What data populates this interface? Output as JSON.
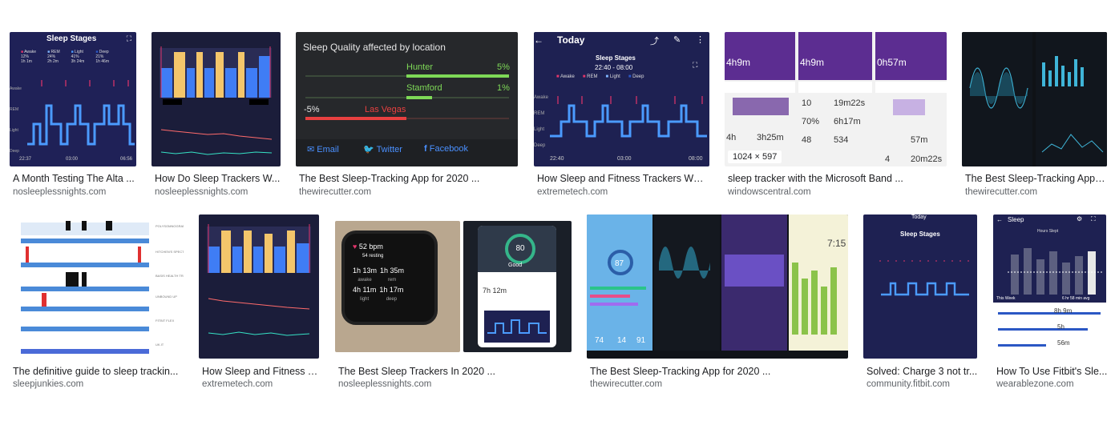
{
  "results": [
    {
      "title": "A Month Testing The Alta ...",
      "domain": "nosleeplessnights.com"
    },
    {
      "title": "How Do Sleep Trackers W...",
      "domain": "nosleeplessnights.com"
    },
    {
      "title": "The Best Sleep-Tracking App for 2020 ...",
      "domain": "thewirecutter.com"
    },
    {
      "title": "How Sleep and Fitness Trackers Wor...",
      "domain": "extremetech.com"
    },
    {
      "title": "sleep tracker with the Microsoft Band ...",
      "domain": "windowscentral.com",
      "size_badge": "1024 × 597"
    },
    {
      "title": "The Best Sleep-Tracking App f...",
      "domain": "thewirecutter.com"
    },
    {
      "title": "The definitive guide to sleep trackin...",
      "domain": "sleepjunkies.com"
    },
    {
      "title": "How Sleep and Fitness T...",
      "domain": "extremetech.com"
    },
    {
      "title": "The Best Sleep Trackers In 2020 ...",
      "domain": "nosleeplessnights.com"
    },
    {
      "title": "The Best Sleep-Tracking App for 2020 ...",
      "domain": "thewirecutter.com"
    },
    {
      "title": "Solved: Charge 3 not tr...",
      "domain": "community.fitbit.com"
    },
    {
      "title": "How To Use Fitbit's Sle...",
      "domain": "wearablezone.com"
    }
  ],
  "thumb1": {
    "heading": "Sleep Stages",
    "legend": [
      {
        "label": "Awake",
        "pct": "12%",
        "dur": "1h 1m"
      },
      {
        "label": "REM",
        "pct": "24%",
        "dur": "2h 2m"
      },
      {
        "label": "Light",
        "pct": "41%",
        "dur": "3h 24m"
      },
      {
        "label": "Deep",
        "pct": "21%",
        "dur": "1h 46m"
      }
    ],
    "axis": [
      "Awake",
      "REM",
      "Light",
      "Deep"
    ],
    "times": [
      "22:37",
      "03:00",
      "06:56"
    ]
  },
  "thumb3": {
    "heading": "Sleep Quality affected by location",
    "rows": [
      {
        "name": "Hunter",
        "value": "5%"
      },
      {
        "name": "Stamford",
        "value": "1%"
      },
      {
        "name": "Las Vegas",
        "value": "-5%"
      }
    ],
    "share": [
      "Email",
      "Twitter",
      "Facebook"
    ]
  },
  "thumb4": {
    "title": "Today",
    "heading": "Sleep Stages",
    "range": "22:40 - 08:00",
    "legend": [
      "Awake",
      "REM",
      "Light",
      "Deep"
    ],
    "axis": [
      "Awake",
      "REM",
      "Light",
      "Deep"
    ],
    "times": [
      "22:40",
      "03:00",
      "08:00"
    ]
  },
  "thumb9": {
    "watch": {
      "bpm": "52 bpm",
      "resting": "54 resting",
      "awake": "1h 13m",
      "awake_label": "awake",
      "rem": "1h 35m",
      "rem_label": "rem",
      "light": "4h 11m",
      "light_label": "light",
      "deep": "1h 17m",
      "deep_label": "deep"
    },
    "phone": {
      "score": "80",
      "quality": "Good",
      "asleep": "7h 12m"
    }
  },
  "thumb11": {
    "title": "Today",
    "heading": "Sleep Stages"
  },
  "thumb12": {
    "title": "Sleep",
    "subtitle": "Hours Slept",
    "week": "This Week",
    "avg": "6 hr 58 min avg",
    "row1": "8h 9m",
    "row2": "5h",
    "row3": "56m"
  }
}
